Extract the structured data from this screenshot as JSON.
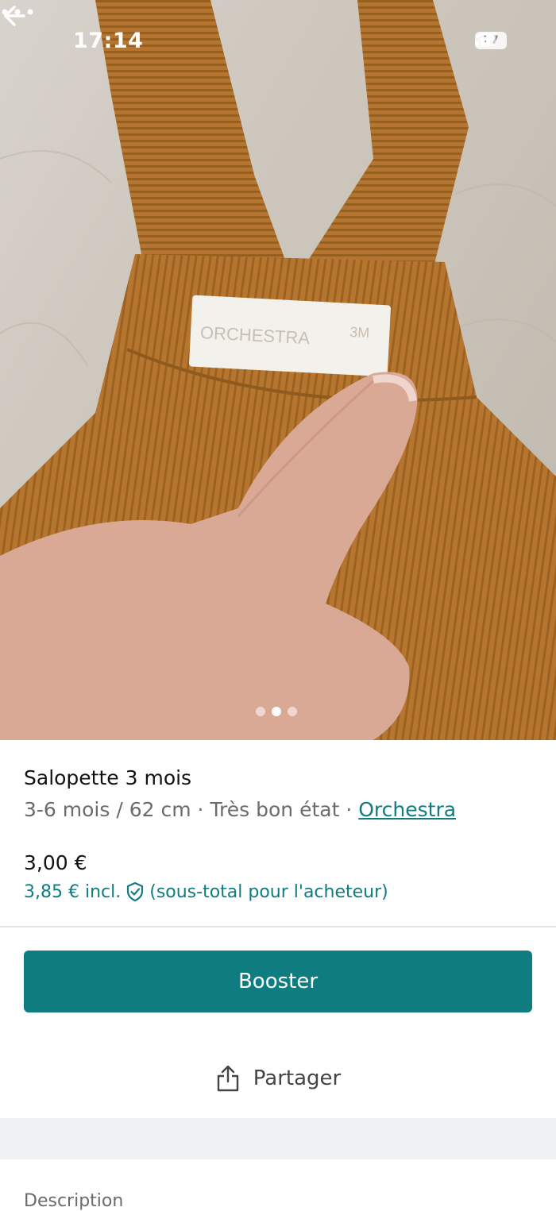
{
  "status_bar": {
    "time": "17:14",
    "battery": "27"
  },
  "photo": {
    "label_text": "ORCHESTRA",
    "label_size": "3M",
    "carousel_total": 3,
    "carousel_active": 2
  },
  "item": {
    "title": "Salopette 3 mois",
    "size": "3-6 mois / 62 cm",
    "separator": "·",
    "condition": "Très bon état",
    "brand": "Orchestra",
    "price": "3,00 €",
    "price_incl": "3,85 € incl.",
    "price_incl_note": "(sous-total pour l'acheteur)"
  },
  "actions": {
    "booster_label": "Booster",
    "share_label": "Partager"
  },
  "description": {
    "label": "Description"
  },
  "colors": {
    "accent": "#0f7c80",
    "fabric": "#b5732e"
  },
  "icons": [
    "back-arrow-icon",
    "more-dots-icon",
    "signal-icon",
    "wifi-icon",
    "battery-icon",
    "shield-check-icon",
    "share-icon"
  ]
}
